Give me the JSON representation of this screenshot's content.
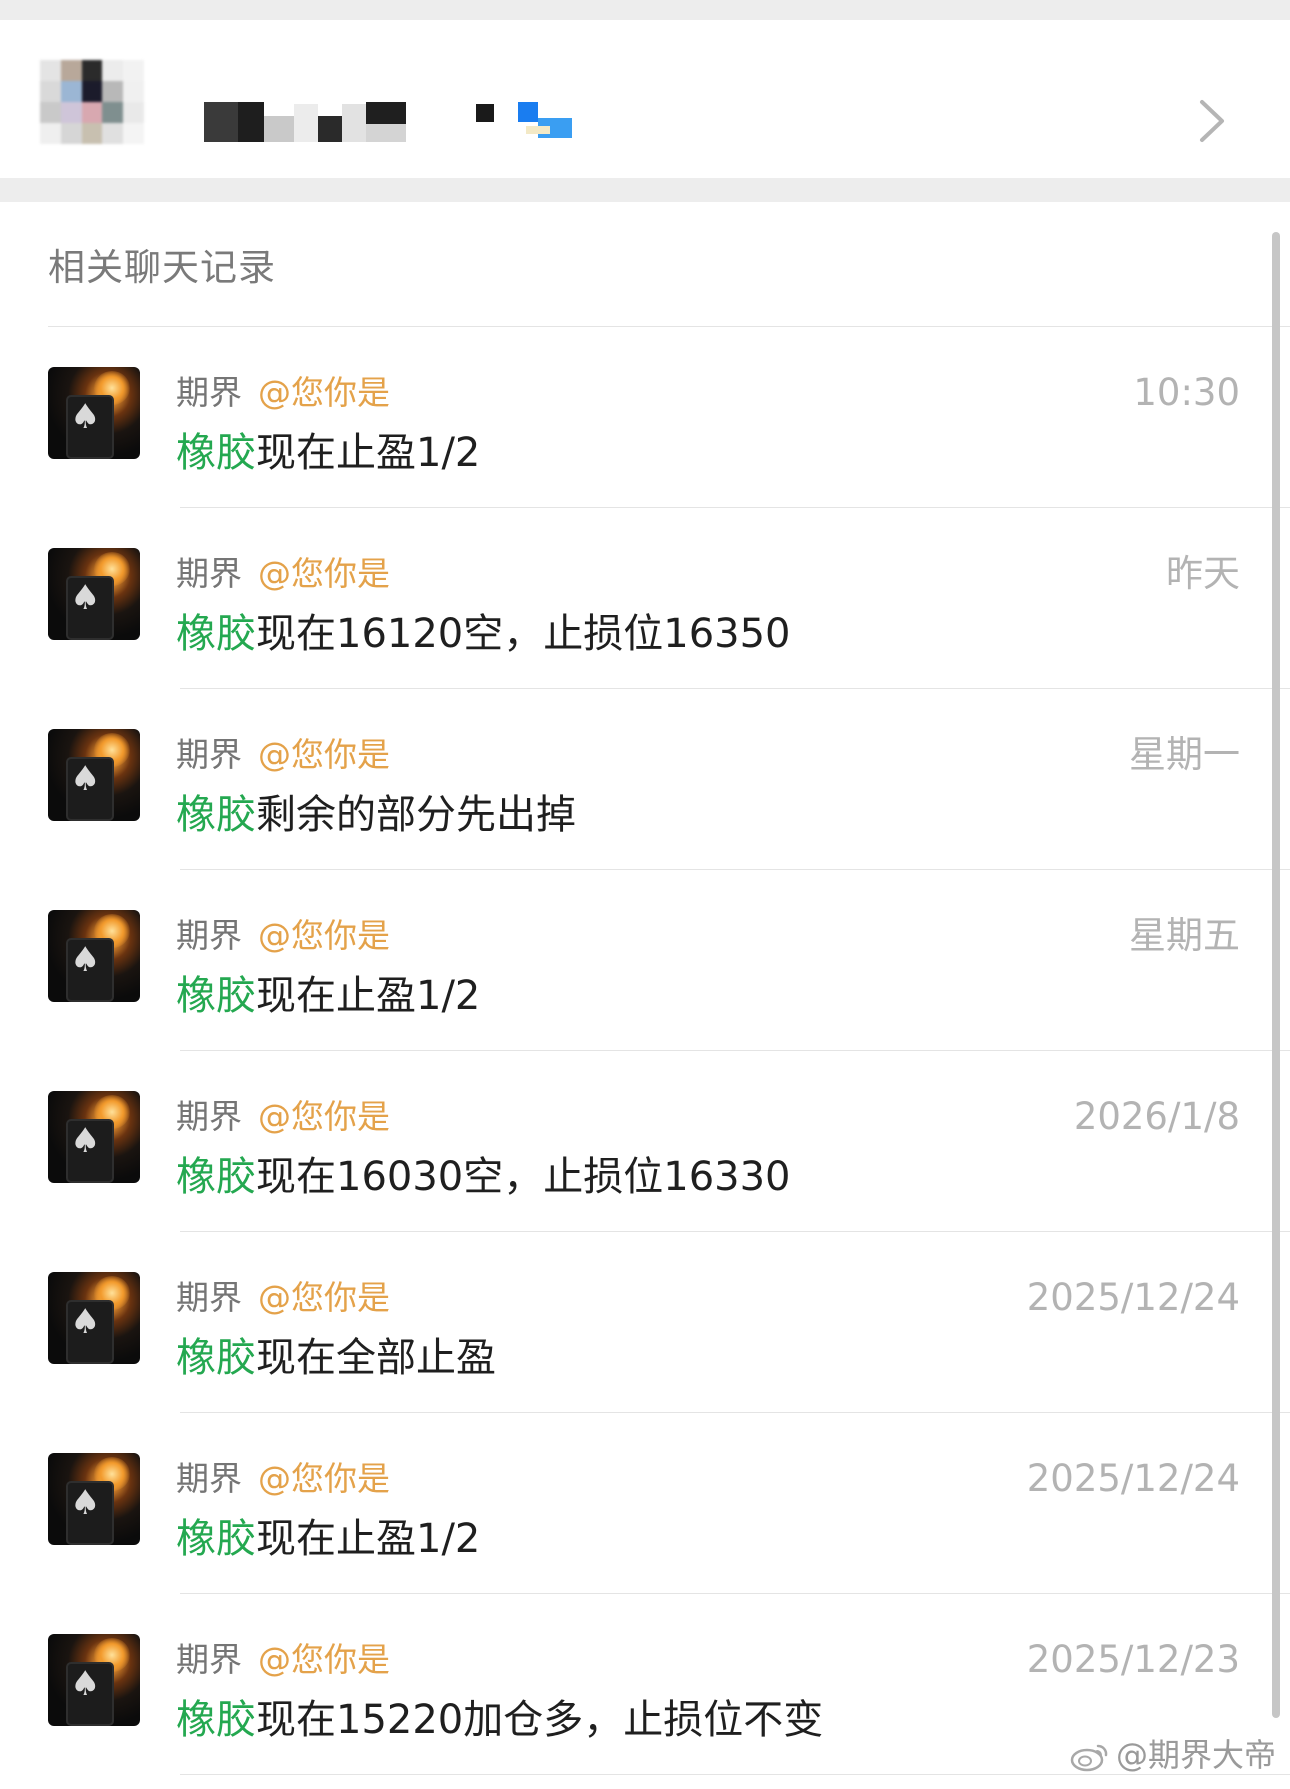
{
  "section_title": "相关聊天记录",
  "messages": [
    {
      "group": "期界",
      "mention": "@您你是",
      "time": "10:30",
      "highlight": "橡胶",
      "text": "现在止盈1/2"
    },
    {
      "group": "期界",
      "mention": "@您你是",
      "time": "昨天",
      "highlight": "橡胶",
      "text": "现在16120空，止损位16350"
    },
    {
      "group": "期界",
      "mention": "@您你是",
      "time": "星期一",
      "highlight": "橡胶",
      "text": "剩余的部分先出掉"
    },
    {
      "group": "期界",
      "mention": "@您你是",
      "time": "星期五",
      "highlight": "橡胶",
      "text": "现在止盈1/2"
    },
    {
      "group": "期界",
      "mention": "@您你是",
      "time": "2026/1/8",
      "highlight": "橡胶",
      "text": "现在16030空，止损位16330"
    },
    {
      "group": "期界",
      "mention": "@您你是",
      "time": "2025/12/24",
      "highlight": "橡胶",
      "text": "现在全部止盈"
    },
    {
      "group": "期界",
      "mention": "@您你是",
      "time": "2025/12/24",
      "highlight": "橡胶",
      "text": "现在止盈1/2"
    },
    {
      "group": "期界",
      "mention": "@您你是",
      "time": "2025/12/23",
      "highlight": "橡胶",
      "text": "现在15220加仓多，止损位不变"
    }
  ],
  "watermark": "@期界大帝",
  "icons": {
    "chevron": "chevron-right-icon",
    "weibo": "weibo-icon"
  },
  "colors": {
    "highlight": "#24a850",
    "mention": "#e4a24a"
  }
}
